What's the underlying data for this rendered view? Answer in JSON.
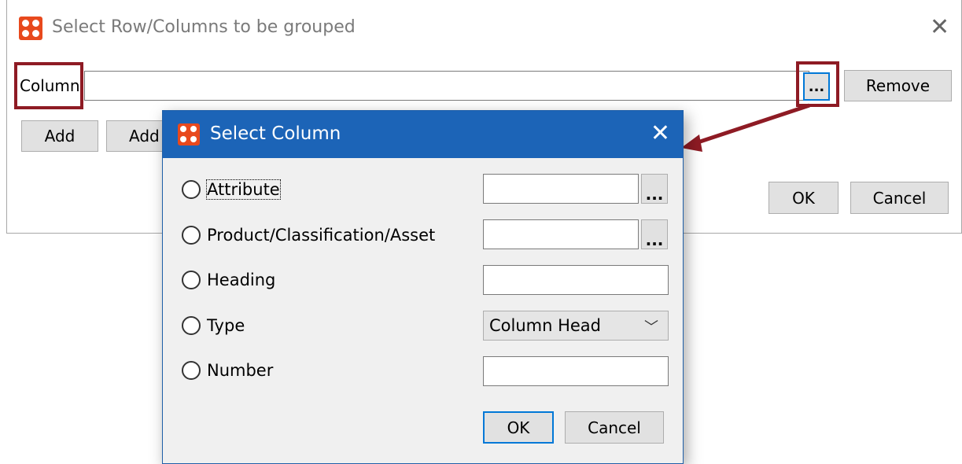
{
  "parent_dialog": {
    "title": "Select Row/Columns to be grouped",
    "column_label": "Column",
    "browse_label": "...",
    "remove_label": "Remove",
    "add_label_1": "Add",
    "add_label_2": "Add",
    "ok_label": "OK",
    "cancel_label": "Cancel"
  },
  "modal": {
    "title": "Select Column",
    "options": [
      {
        "label": "Attribute",
        "has_input": true,
        "has_browse": true
      },
      {
        "label": "Product/Classification/Asset",
        "has_input": true,
        "has_browse": true
      },
      {
        "label": "Heading",
        "has_input": true
      },
      {
        "label": "Type",
        "select_value": "Column Head"
      },
      {
        "label": "Number",
        "has_input": true
      }
    ],
    "browse_label": "...",
    "ok_label": "OK",
    "cancel_label": "Cancel"
  },
  "colors": {
    "annotation_red": "#8e1b24",
    "title_bar_blue": "#1c64b7",
    "logo_orange": "#e8491d"
  },
  "icons": [
    "app-logo-icon",
    "close-icon",
    "chevron-down-icon",
    "annotation-arrow"
  ]
}
